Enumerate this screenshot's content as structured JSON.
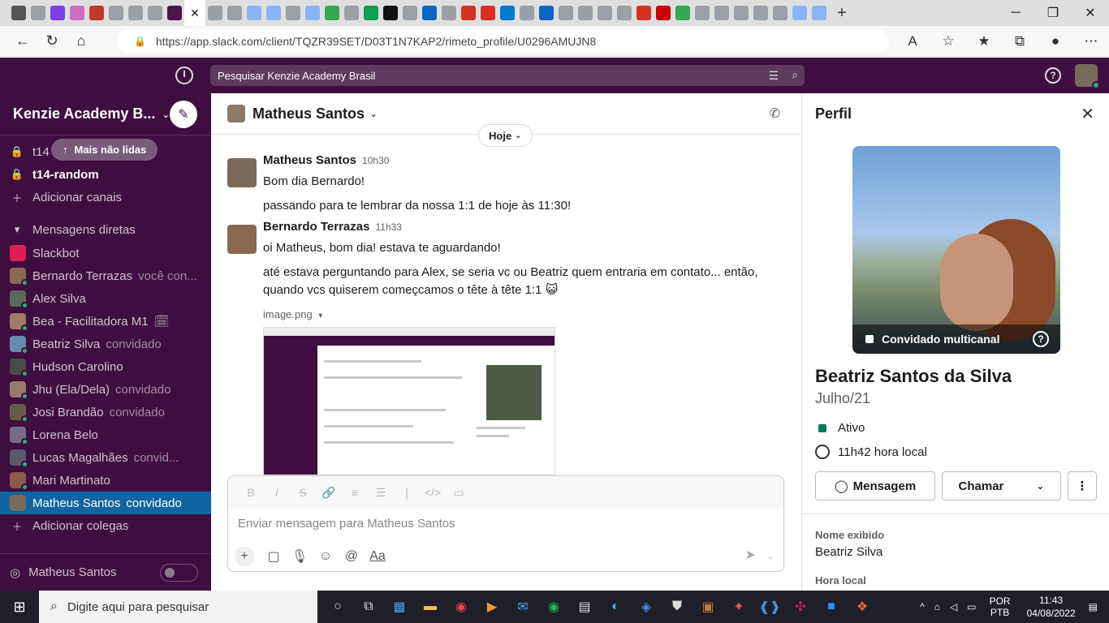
{
  "browser": {
    "url": "https://app.slack.com/client/TQZR39SET/D03T1N7KAP2/rimeto_profile/U0296AMUJN8"
  },
  "slack": {
    "search_placeholder": "Pesquisar Kenzie Academy Brasil",
    "workspace_name": "Kenzie Academy B...",
    "unread_pill": "Mais não lidas",
    "channels": [
      {
        "label": "t14",
        "bold": false
      },
      {
        "label": "t14-random",
        "bold": true
      }
    ],
    "add_channels": "Adicionar canais",
    "dm_header": "Mensagens diretas",
    "dms": [
      {
        "name": "Slackbot",
        "sub": "",
        "color": "#e01e5a",
        "status": ""
      },
      {
        "name": "Bernardo Terrazas",
        "sub": "você con...",
        "color": "#8a6a50",
        "status": "#2bac76"
      },
      {
        "name": "Alex Silva",
        "sub": "",
        "color": "#5a6a5a",
        "status": "#2bac76"
      },
      {
        "name": "Bea - Facilitadora M1",
        "sub": "🗓",
        "color": "#a07a6a",
        "status": "#2bac76"
      },
      {
        "name": "Beatriz Silva",
        "sub": "convidado",
        "color": "#6a8aaa",
        "status": "#2bac76"
      },
      {
        "name": "Hudson Carolino",
        "sub": "",
        "color": "#4a4a4a",
        "status": "#2bac76"
      },
      {
        "name": "Jhu (Ela/Dela)",
        "sub": "convidado",
        "color": "#9a7a6a",
        "status": "#2bac76"
      },
      {
        "name": "Josi Brandão",
        "sub": "convidado",
        "color": "#6a5a4a",
        "status": "#2bac76"
      },
      {
        "name": "Lorena Belo",
        "sub": "",
        "color": "#7a6a8a",
        "status": "#2bac76"
      },
      {
        "name": "Lucas Magalhães",
        "sub": "convid...",
        "color": "#5a5a6a",
        "status": "#2bac76"
      },
      {
        "name": "Mari Martinato",
        "sub": "",
        "color": "#8a5a4a",
        "status": "#2bac76"
      },
      {
        "name": "Matheus Santos",
        "sub": "convidado",
        "color": "#7a6a5a",
        "status": ""
      }
    ],
    "add_colleagues": "Adicionar colegas",
    "huddle_name": "Matheus Santos",
    "channel_title": "Matheus Santos",
    "day_divider": "Hoje",
    "messages": [
      {
        "author": "Matheus Santos",
        "time": "10h30",
        "lines": [
          "Bom dia Bernardo!",
          "passando para te lembrar da nossa 1:1 de hoje às 11:30!"
        ]
      },
      {
        "author": "Bernardo Terrazas",
        "time": "11h33",
        "lines": [
          "oi Matheus, bom dia! estava te aguardando!",
          "até estava perguntando para Alex, se seria vc ou Beatriz quem entraria em contato... então,",
          "quando vcs quiserem começcamos o tête à tête 1:1 😺"
        ]
      }
    ],
    "attachment_name": "image.png",
    "composer_placeholder": "Enviar mensagem para Matheus Santos",
    "composer_aa": "Aa"
  },
  "profile": {
    "header": "Perfil",
    "photo_badge": "Convidado multicanal",
    "name": "Beatriz Santos da Silva",
    "title": "Julho/21",
    "status": "Ativo",
    "local_time": "11h42 hora local",
    "message_button": "Mensagem",
    "call_button": "Chamar",
    "display_name_label": "Nome exibido",
    "display_name_value": "Beatriz Silva",
    "local_time_label": "Hora local"
  },
  "taskbar": {
    "search_placeholder": "Digite aqui para pesquisar",
    "lang_top": "POR",
    "lang_bottom": "PTB",
    "time": "11:43",
    "date": "04/08/2022"
  },
  "colors": {
    "sidebar": "#3f0e40",
    "active_item": "#1164a3",
    "online": "#2bac76"
  }
}
